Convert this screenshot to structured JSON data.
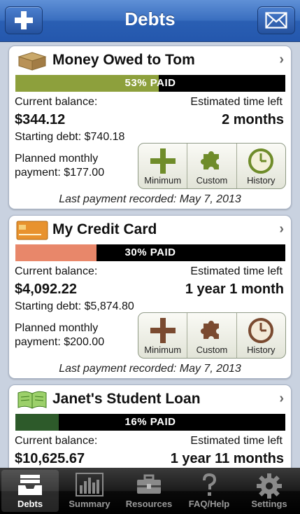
{
  "nav": {
    "title": "Debts",
    "add_icon": "plus-icon",
    "mail_icon": "envelope-icon"
  },
  "debts": [
    {
      "name": "Money Owed to Tom",
      "icon": "box-icon",
      "paid_fraction": 0.53,
      "paid_text": "53% PAID",
      "bar_color": "#8da03c",
      "current_balance_label": "Current balance:",
      "current_balance": "$344.12",
      "time_left_label": "Estimated time left",
      "time_left": "2 months",
      "starting_debt": "Starting debt: $740.18",
      "planned_line1": "Planned monthly",
      "planned_line2": "payment: $177.00",
      "buttons": [
        "Minimum",
        "Custom",
        "History"
      ],
      "button_tint": "green",
      "last_payment": "Last payment recorded: May 7, 2013"
    },
    {
      "name": "My Credit Card",
      "icon": "credit-card-icon",
      "paid_fraction": 0.3,
      "paid_text": "30% PAID",
      "bar_color": "#e8876a",
      "current_balance_label": "Current balance:",
      "current_balance": "$4,092.22",
      "time_left_label": "Estimated time left",
      "time_left": "1 year 1 month",
      "starting_debt": "Starting debt: $5,874.80",
      "planned_line1": "Planned monthly",
      "planned_line2": "payment: $200.00",
      "buttons": [
        "Minimum",
        "Custom",
        "History"
      ],
      "button_tint": "brown",
      "last_payment": "Last payment recorded: May 7, 2013"
    },
    {
      "name": "Janet's Student Loan",
      "icon": "book-icon",
      "paid_fraction": 0.16,
      "paid_text": "16% PAID",
      "bar_color": "#2d5a2a",
      "current_balance_label": "Current balance:",
      "current_balance": "$10,625.67",
      "time_left_label": "Estimated time left",
      "time_left": "1 year 11 months"
    }
  ],
  "tabs": [
    {
      "label": "Debts",
      "icon": "inbox-icon",
      "active": true
    },
    {
      "label": "Summary",
      "icon": "bar-chart-icon",
      "active": false
    },
    {
      "label": "Resources",
      "icon": "toolbox-icon",
      "active": false
    },
    {
      "label": "FAQ/Help",
      "icon": "question-icon",
      "active": false
    },
    {
      "label": "Settings",
      "icon": "gear-icon",
      "active": false
    }
  ]
}
